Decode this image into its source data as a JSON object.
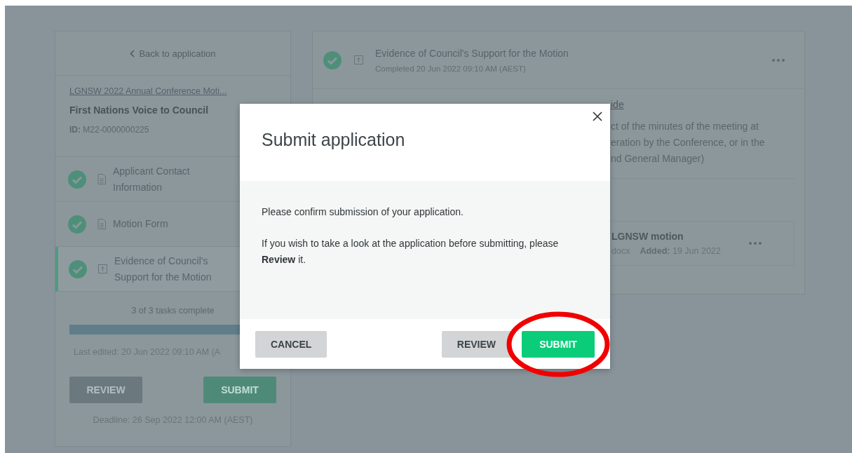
{
  "sidebar": {
    "back_link": "Back to application",
    "program_link": "LGNSW 2022 Annual Conference Moti...",
    "application_title": "First Nations Voice to Council",
    "application_id": "**ID:** M22-0000000225",
    "tasks": [
      {
        "title": "Applicant Contact Information",
        "kind": "form",
        "completed": true,
        "selected": false
      },
      {
        "title": "Motion Form",
        "kind": "form",
        "completed": true,
        "selected": false
      },
      {
        "title": "Evidence of Council's Support for the Motion",
        "kind": "upload",
        "completed": true,
        "selected": true
      }
    ],
    "progress_text": "3 of 3 tasks complete",
    "progress": {
      "level": 1
    },
    "last_edited": "Last edited: 20 Jun 2022 09:10 AM (A",
    "buttons": [
      {
        "label": "REVIEW",
        "kind": "secondary"
      },
      {
        "label": "SUBMIT",
        "kind": "primary"
      }
    ],
    "deadline": "Deadline: 26 Sep 2022 12:00 AM (AEST)"
  },
  "task_panel": {
    "title": "Evidence of Council's Support for the Motion",
    "kind": "upload",
    "completed": true,
    "status": "Completed 20 Jun 2022 09:10 AM (AEST)",
    "guide_link": "ide",
    "description_lines": [
      "ct of the minutes of the meeting at",
      "eration by the Conference, or in the",
      "nd General Manager)"
    ],
    "file": {
      "name": "LGNSW motion",
      "type": "docx",
      "added": "**Added:** 19 Jun 2022"
    }
  },
  "modal": {
    "title": "Submit application",
    "paragraphs": [
      "Please confirm submission of your application.",
      "If you wish to take a look at the application before submitting, please **Review** it."
    ],
    "buttons": [
      {
        "label": "CANCEL",
        "kind": "secondary",
        "highlighted": false
      },
      {
        "label": "REVIEW",
        "kind": "secondary",
        "highlighted": false
      },
      {
        "label": "SUBMIT",
        "kind": "primary",
        "highlighted": true
      }
    ]
  }
}
